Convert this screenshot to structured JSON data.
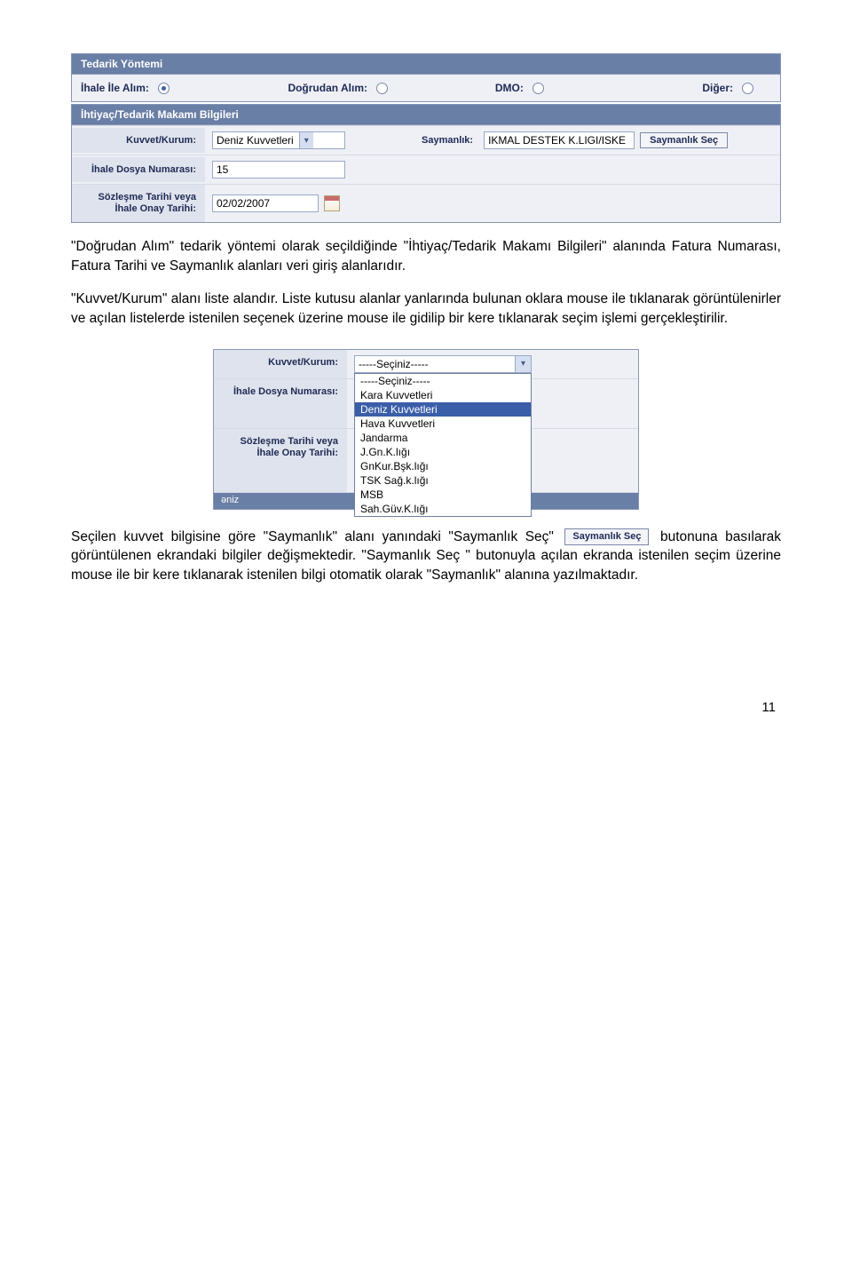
{
  "panel1": {
    "title": "Tedarik Yöntemi",
    "radios": [
      {
        "label": "İhale İle Alım:",
        "checked": true
      },
      {
        "label": "Doğrudan Alım:",
        "checked": false
      },
      {
        "label": "DMO:",
        "checked": false
      },
      {
        "label": "Diğer:",
        "checked": false
      }
    ]
  },
  "panel2": {
    "title": "İhtiyaç/Tedarik Makamı Bilgileri",
    "rows": {
      "kuvvet_label": "Kuvvet/Kurum:",
      "kuvvet_value": "Deniz Kuvvetleri",
      "sayman_label": "Saymanlık:",
      "sayman_value": "IKMAL DESTEK K.LIGI/ISKE",
      "sayman_btn": "Saymanlık Seç",
      "dosya_label": "İhale Dosya Numarası:",
      "dosya_value": "15",
      "tarih_label": "Sözleşme Tarihi veya İhale Onay Tarihi:",
      "tarih_value": "02/02/2007"
    }
  },
  "para1": "\"Doğrudan Alım\" tedarik yöntemi olarak seçildiğinde \"İhtiyaç/Tedarik Makamı Bilgileri\" alanında Fatura Numarası, Fatura Tarihi ve Saymanlık alanları veri giriş alanlarıdır.",
  "para2": "\"Kuvvet/Kurum\" alanı liste alandır. Liste kutusu alanlar yanlarında bulunan oklara mouse ile tıklanarak görüntülenirler ve açılan listelerde istenilen seçenek üzerine mouse ile gidilip bir kere tıklanarak seçim işlemi gerçekleştirilir.",
  "dropdown_shot": {
    "kuvvet_label": "Kuvvet/Kurum:",
    "kuvvet_selected": "-----Seçiniz-----",
    "dosya_label": "İhale Dosya Numarası:",
    "tarih_label": "Sözleşme Tarihi veya İhale Onay Tarihi:",
    "tail": "əniz",
    "options": [
      "-----Seçiniz-----",
      "Kara Kuvvetleri",
      "Deniz Kuvvetleri",
      "Hava Kuvvetleri",
      "Jandarma",
      "J.Gn.K.lığı",
      "GnKur.Bşk.lığı",
      "TSK Sağ.k.lığı",
      "MSB",
      "Sah.Güv.K.lığı"
    ],
    "selected_index": 2
  },
  "para3_a": "Seçilen kuvvet bilgisine göre \"Saymanlık\" alanı yanındaki \"Saymanlık Seç\"",
  "para3_btn": "Saymanlık Seç",
  "para3_b": "butonuna basılarak görüntülenen ekrandaki bilgiler değişmektedir. \"Saymanlık Seç \" butonuyla açılan ekranda istenilen seçim üzerine mouse ile bir kere tıklanarak istenilen bilgi otomatik olarak \"Saymanlık\" alanına yazılmaktadır.",
  "page_number": "11"
}
